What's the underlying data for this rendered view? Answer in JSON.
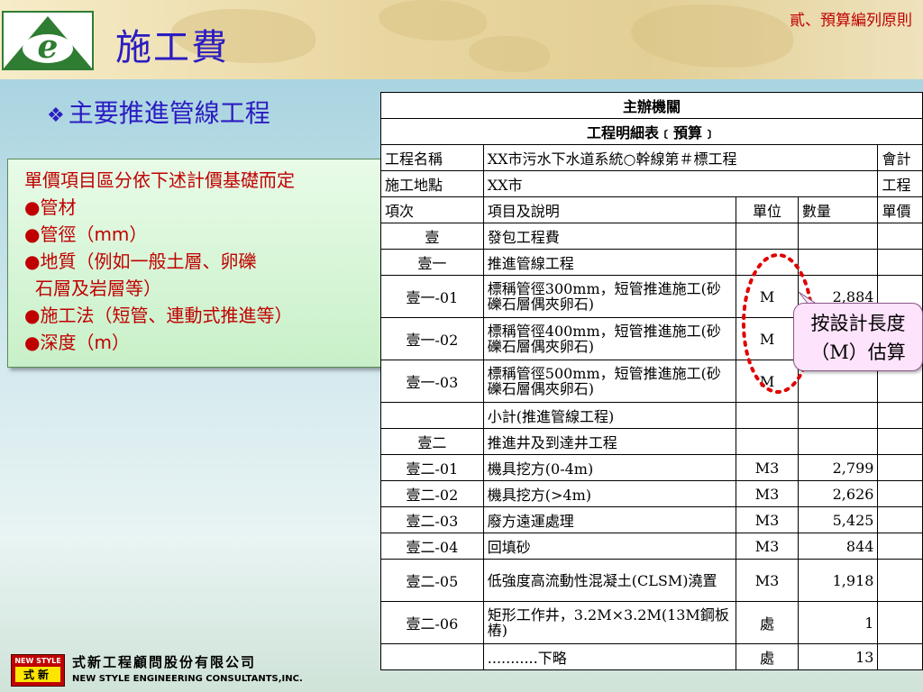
{
  "header": {
    "title": "施工費",
    "section": "貳、預算編列原則"
  },
  "bullet_title": "主要推進管線工程",
  "callout": {
    "heading": "單價項目區分依下述計價基礎而定",
    "items": [
      {
        "line1": "管材"
      },
      {
        "line1": "管徑（mm）"
      },
      {
        "line1": "地質（例如一般土層、卵礫",
        "line2": "石層及岩層等）"
      },
      {
        "line1": "施工法（短管、連動式推進等）"
      },
      {
        "line1": "深度（m）"
      }
    ]
  },
  "table": {
    "title1": "主辦機關",
    "title2": "工程明細表﹝預算﹞",
    "meta": [
      {
        "label": "工程名稱",
        "value": "XX市污水下水道系統○幹線第＃標工程",
        "extra": "會計"
      },
      {
        "label": "施工地點",
        "value": "XX市",
        "extra": "工程"
      }
    ],
    "columns": [
      "項次",
      "項目及說明",
      "單位",
      "數量",
      "單價"
    ],
    "rows": [
      {
        "no": "壹",
        "desc": "發包工程費",
        "unit": "",
        "qty": ""
      },
      {
        "no": "壹一",
        "desc": "推進管線工程",
        "unit": "",
        "qty": ""
      },
      {
        "no": "壹一-01",
        "desc": "標稱管徑300mm，短管推進施工(砂礫石層偶夾卵石)",
        "unit": "M",
        "qty": "2,884"
      },
      {
        "no": "壹一-02",
        "desc": "標稱管徑400mm，短管推進施工(砂礫石層偶夾卵石)",
        "unit": "M",
        "qty": ""
      },
      {
        "no": "壹一-03",
        "desc": "標稱管徑500mm，短管推進施工(砂礫石層偶夾卵石)",
        "unit": "M",
        "qty": ""
      },
      {
        "no": "",
        "desc": "小計(推進管線工程)",
        "unit": "",
        "qty": ""
      },
      {
        "no": "壹二",
        "desc": "推進井及到達井工程",
        "unit": "",
        "qty": ""
      },
      {
        "no": "壹二-01",
        "desc": "機具挖方(0-4m)",
        "unit": "M3",
        "qty": "2,799"
      },
      {
        "no": "壹二-02",
        "desc": "機具挖方(>4m)",
        "unit": "M3",
        "qty": "2,626"
      },
      {
        "no": "壹二-03",
        "desc": "廢方遠運處理",
        "unit": "M3",
        "qty": "5,425"
      },
      {
        "no": "壹二-04",
        "desc": "回填砂",
        "unit": "M3",
        "qty": "844"
      },
      {
        "no": "壹二-05",
        "desc": "低強度高流動性混凝土(CLSM)澆置",
        "unit": "M3",
        "qty": "1,918"
      },
      {
        "no": "壹二-06",
        "desc": "矩形工作井，3.2M×3.2M(13M鋼板樁)",
        "unit": "處",
        "qty": "1"
      },
      {
        "no": "",
        "desc": "...........下略",
        "unit": "處",
        "qty": "13"
      }
    ]
  },
  "note": {
    "line1": "按設計長度",
    "line2": "（M）估算"
  },
  "footer": {
    "logo_top": "NEW STYLE",
    "logo_bottom": "式新",
    "company_cn": "式新工程顧問股份有限公司",
    "company_en": "NEW STYLE ENGINEERING CONSULTANTS,INC."
  },
  "colors": {
    "title_blue": "#2b1cc2",
    "accent_red": "#c00000",
    "callout_green": "#c8f0c8",
    "note_pink": "#fde3fb"
  }
}
